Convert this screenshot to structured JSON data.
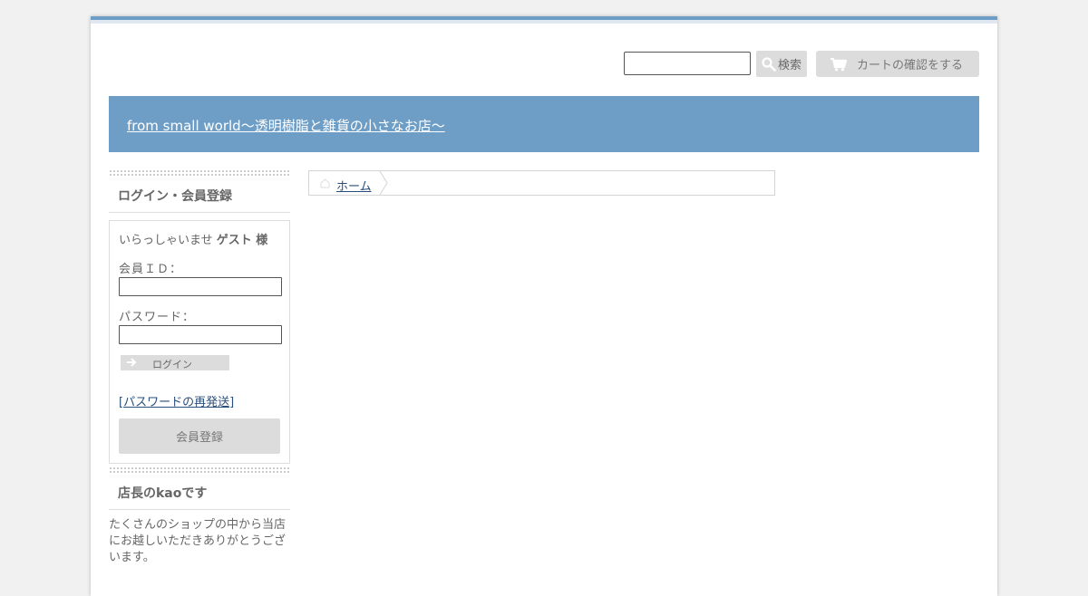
{
  "header": {
    "search_placeholder": "",
    "search_button_label": "検索",
    "cart_button_label": "カートの確認をする"
  },
  "banner": {
    "shop_title": "from small world～透明樹脂と雑貨の小さなお店～"
  },
  "login": {
    "heading": "ログイン・会員登録",
    "greeting_prefix": "いらっしゃいませ",
    "greeting_name": "ゲスト 様",
    "member_id_label": "会員ＩＤ：",
    "password_label": "パスワード：",
    "login_button_label": "ログイン",
    "resend_link": "[パスワードの再発送]",
    "register_button_label": "会員登録"
  },
  "about": {
    "heading": "店長のkaoです",
    "text": "たくさんのショップの中から当店にお越しいただきありがとうございます。"
  },
  "breadcrumb": {
    "home_label": "ホーム"
  },
  "colors": {
    "accent": "#6e9ec6",
    "button_bg": "#dcdcdc",
    "link": "#2a4e7a"
  }
}
